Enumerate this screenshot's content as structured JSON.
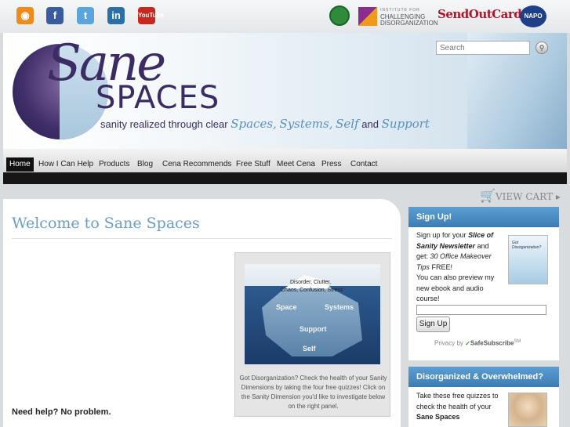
{
  "social": {
    "rss": "rss-icon",
    "facebook": "f",
    "twitter": "t",
    "linkedin": "in",
    "youtube": "YouTube"
  },
  "partners": {
    "icd_small": "INSTITUTE FOR",
    "icd_line1": "CHALLENGING",
    "icd_line2": "DISORGANIZATION",
    "sendoutcards": "SendOutCards",
    "napo": "NAPO"
  },
  "header": {
    "logo_sane": "Sane",
    "logo_spaces": "SPACES",
    "tagline_prefix": "sanity realized through clear",
    "tagline_spaces": "Spaces,",
    "tagline_systems": "Systems,",
    "tagline_self": "Self",
    "tagline_and": "and",
    "tagline_support": "Support"
  },
  "search": {
    "placeholder": "Search"
  },
  "nav": {
    "items": [
      "Home",
      "How I Can Help",
      "Products",
      "Blog",
      "Cena Recommends",
      "Free Stuff",
      "Meet Cena",
      "Press",
      "Contact"
    ]
  },
  "cart": {
    "label": "VIEW CART"
  },
  "main": {
    "title": "Welcome to Sane Spaces",
    "iceberg": {
      "line1": "Disorder, Clutter,",
      "line2": "Chaos, Confusion, Stress",
      "space": "Space",
      "systems": "Systems",
      "support": "Support",
      "self": "Self"
    },
    "caption": "Got Disorganization? Check the health of your Sanity Dimensions by taking the four free quizzes! Click on the Sanity Dimension you'd like to investigate below on the right panel.",
    "need_help": "Need help? No problem."
  },
  "signup": {
    "heading": "Sign Up!",
    "text1": "Sign up for your",
    "newsletter": "Slice of Sanity Newsletter",
    "text2": "and get:",
    "tips": "30 Office Makeover Tips",
    "text3": "FREE!",
    "text4": "You can also preview my new ebook and audio course!",
    "button": "Sign Up",
    "privacy": "Privacy by",
    "safesubscribe": "SafeSubscribe",
    "sm": "SM",
    "ebook_title": "Got Disorganization?"
  },
  "disorganized": {
    "heading": "Disorganized & Overwhelmed?",
    "text": "Take these free quizzes to check the health of your",
    "text_bold": "Sane Spaces"
  },
  "colors": {
    "accent": "#5c9ed2",
    "brand_purple": "#3b2d63",
    "title_blue": "#6a9ec4"
  }
}
